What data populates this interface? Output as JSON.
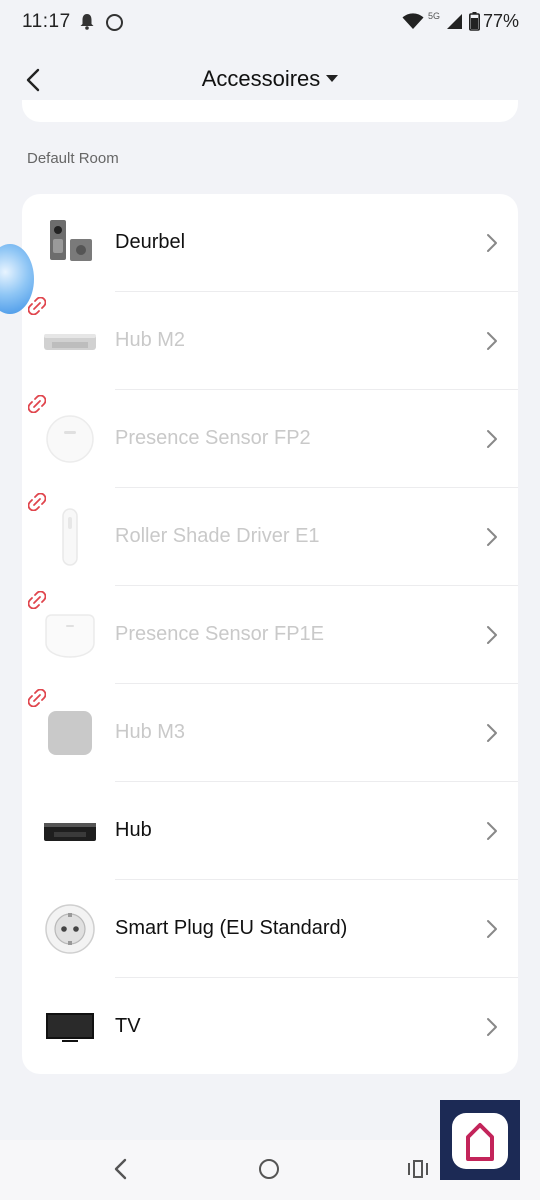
{
  "status_bar": {
    "time": "11:17",
    "network": "5G",
    "battery": "77%"
  },
  "header": {
    "title": "Accessoires"
  },
  "section": {
    "label": "Default Room"
  },
  "devices": [
    {
      "name": "Deurbel",
      "offline": false,
      "icon": "doorbell-icon"
    },
    {
      "name": "Hub M2",
      "offline": true,
      "icon": "hub-m2-icon"
    },
    {
      "name": "Presence Sensor FP2",
      "offline": true,
      "icon": "presence-sensor-icon"
    },
    {
      "name": "Roller Shade Driver E1",
      "offline": true,
      "icon": "roller-shade-icon"
    },
    {
      "name": "Presence Sensor FP1E",
      "offline": true,
      "icon": "presence-sensor-fp1e-icon"
    },
    {
      "name": "Hub M3",
      "offline": true,
      "icon": "hub-m3-icon"
    },
    {
      "name": "Hub",
      "offline": false,
      "icon": "hub-icon"
    },
    {
      "name": "Smart Plug (EU Standard)",
      "offline": false,
      "icon": "smart-plug-icon"
    },
    {
      "name": "TV",
      "offline": false,
      "icon": "tv-icon"
    }
  ],
  "colors": {
    "background": "#f2f3f7",
    "card": "#ffffff",
    "offline_text": "#c9c9c9",
    "unlink_red": "#e0454d",
    "badge_bg": "#1c2a55",
    "badge_accent": "#c3245a"
  }
}
